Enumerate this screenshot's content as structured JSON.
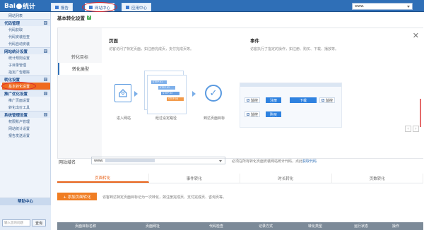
{
  "topbar": {
    "logo_text": "Bai",
    "logo_suffix": "统计",
    "tabs": [
      {
        "label": "报告",
        "active": false
      },
      {
        "label": "网站中心",
        "active": true
      },
      {
        "label": "应用中心",
        "active": false
      }
    ],
    "site_selector": "www."
  },
  "sidebar": {
    "top_item": "网站列表",
    "sections": [
      {
        "title": "代码管理",
        "toggle": "⊟",
        "items": [
          "代码获取",
          "代码安装检查",
          "代码自动安装"
        ]
      },
      {
        "title": "网站统计设置",
        "toggle": "⊟",
        "items": [
          "统计规则设置",
          "子目录管理",
          "指定广告跟踪"
        ]
      },
      {
        "title": "转化设置",
        "toggle": "⊟",
        "items": [
          "基本转化设置"
        ]
      },
      {
        "title": "推广优化设置",
        "toggle": "⊟",
        "items": [
          "推广页面设置",
          "转化出价工具"
        ]
      },
      {
        "title": "系统管理设置",
        "toggle": "⊟",
        "items": [
          "权限账户管理",
          "网站统计设置",
          "报告发送设置"
        ]
      }
    ],
    "active_item": "基本转化设置",
    "help": {
      "title": "帮助中心",
      "input_placeholder": "输入您的问题",
      "button": "查询"
    }
  },
  "main": {
    "page_title": "基本转化设置",
    "help_icon": "?",
    "panel_tabs": [
      "转化目标",
      "转化类型"
    ],
    "page_col": {
      "title": "页面",
      "desc": "访客访问了特定页面，如注册完成页，支付完成页等。"
    },
    "event_col": {
      "title": "事件",
      "desc": "访客执行了指定的操作，如注册、购买、下载、播放等。"
    },
    "flow": {
      "label1": "进入网站",
      "label2": "经过设定路径",
      "label3": "到达页面目标",
      "steps": [
        "STEP 01",
        "STEP 02",
        "STEP 03",
        "STEP 04"
      ]
    },
    "event_demo": {
      "chips": [
        "监控",
        "监控",
        "监控"
      ],
      "buttons": [
        "注册",
        "下载",
        "购买"
      ]
    },
    "close": "✕",
    "prev": "‹",
    "next": "›",
    "form": {
      "label": "网站域名",
      "value": "www.",
      "note": "必须在所有转化页面安装网站统计代码，点此",
      "link": "获取代码"
    },
    "tabs": [
      "页面转化",
      "事件转化",
      "时长转化",
      "页数转化"
    ],
    "add_button": "+ 添加页面转化",
    "add_desc": "访客到达特定页面目标记为一次转化，如注册完成页、支付完成页、咨询页等。",
    "table_headers": [
      "页面目标名称",
      "页面网址",
      "代码检查",
      "记录方式",
      "转化类型",
      "运行状态",
      "操作"
    ]
  }
}
